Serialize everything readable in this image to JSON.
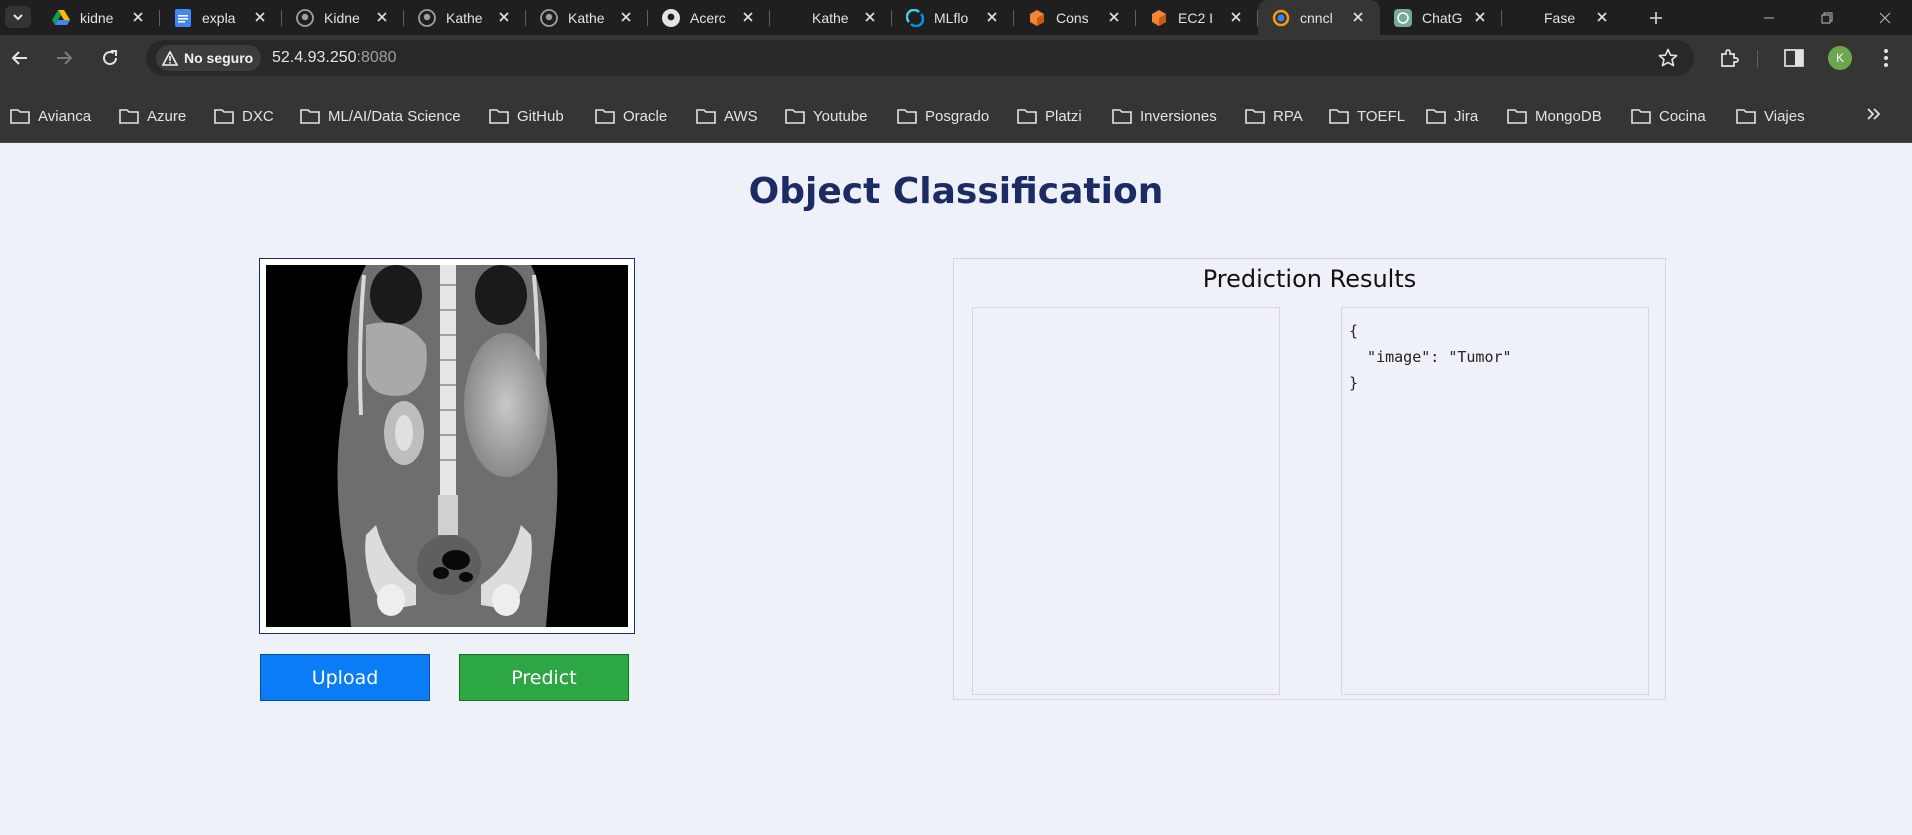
{
  "browser": {
    "tabs": [
      {
        "title": "kidne",
        "icon": "google-drive-icon"
      },
      {
        "title": "expla",
        "icon": "google-docs-icon"
      },
      {
        "title": "Kidne",
        "icon": "github-icon"
      },
      {
        "title": "Kathe",
        "icon": "github-icon"
      },
      {
        "title": "Kathe",
        "icon": "github-icon"
      },
      {
        "title": "Acerc",
        "icon": "github-icon"
      },
      {
        "title": "Kathe",
        "icon": "blank-icon"
      },
      {
        "title": "MLflo",
        "icon": "mlflow-icon"
      },
      {
        "title": "Cons",
        "icon": "aws-icon"
      },
      {
        "title": "EC2 I",
        "icon": "aws-icon"
      },
      {
        "title": "cnncl",
        "icon": "page-icon"
      },
      {
        "title": "ChatG",
        "icon": "chatgpt-icon"
      },
      {
        "title": "Fase",
        "icon": "blank-icon"
      }
    ],
    "security_label": "No seguro",
    "url_host": "52.4.93.250",
    "url_port": ":8080",
    "profile_initial": "K",
    "bookmarks": [
      "Avianca",
      "Azure",
      "DXC",
      "ML/AI/Data Science",
      "GitHub",
      "Oracle",
      "AWS",
      "Youtube",
      "Posgrado",
      "Platzi",
      "Inversiones",
      "RPA",
      "TOEFL",
      "Jira",
      "MongoDB",
      "Cocina",
      "Viajes"
    ]
  },
  "app": {
    "title": "Object Classification",
    "upload_label": "Upload",
    "predict_label": "Predict",
    "results_title": "Prediction Results",
    "result_json": "{\n  \"image\": \"Tumor\"\n}"
  },
  "colors": {
    "title": "#1d2b64",
    "upload": "#0a7cf5",
    "predict": "#2ca743",
    "page_bg": "#eef1f8"
  }
}
